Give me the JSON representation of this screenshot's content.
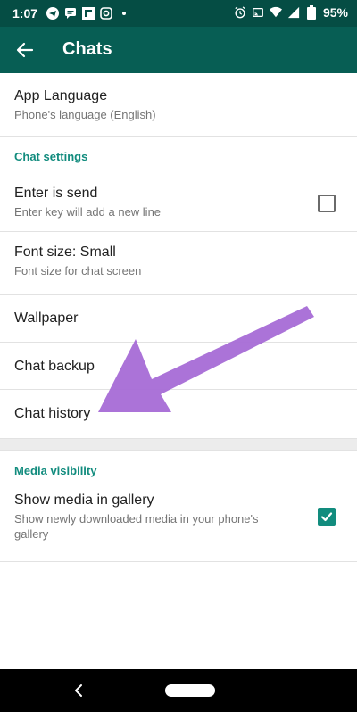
{
  "status_bar": {
    "time": "1:07",
    "battery": "95%"
  },
  "app_bar": {
    "title": "Chats"
  },
  "settings": {
    "app_language": {
      "title": "App Language",
      "subtitle": "Phone's language (English)"
    },
    "chat_settings_header": "Chat settings",
    "enter_is_send": {
      "title": "Enter is send",
      "subtitle": "Enter key will add a new line",
      "checked": false
    },
    "font_size": {
      "title": "Font size: Small",
      "subtitle": "Font size for chat screen"
    },
    "wallpaper": {
      "title": "Wallpaper"
    },
    "chat_backup": {
      "title": "Chat backup"
    },
    "chat_history": {
      "title": "Chat history"
    },
    "media_visibility_header": "Media visibility",
    "show_media": {
      "title": "Show media in gallery",
      "subtitle_line1": "Show newly downloaded media in your phone's",
      "subtitle_line2": "gallery",
      "checked": true
    }
  },
  "colors": {
    "status_bar": "#054d44",
    "app_bar": "#075e54",
    "accent": "#128c7e",
    "annotation_arrow": "#a76bd6"
  }
}
